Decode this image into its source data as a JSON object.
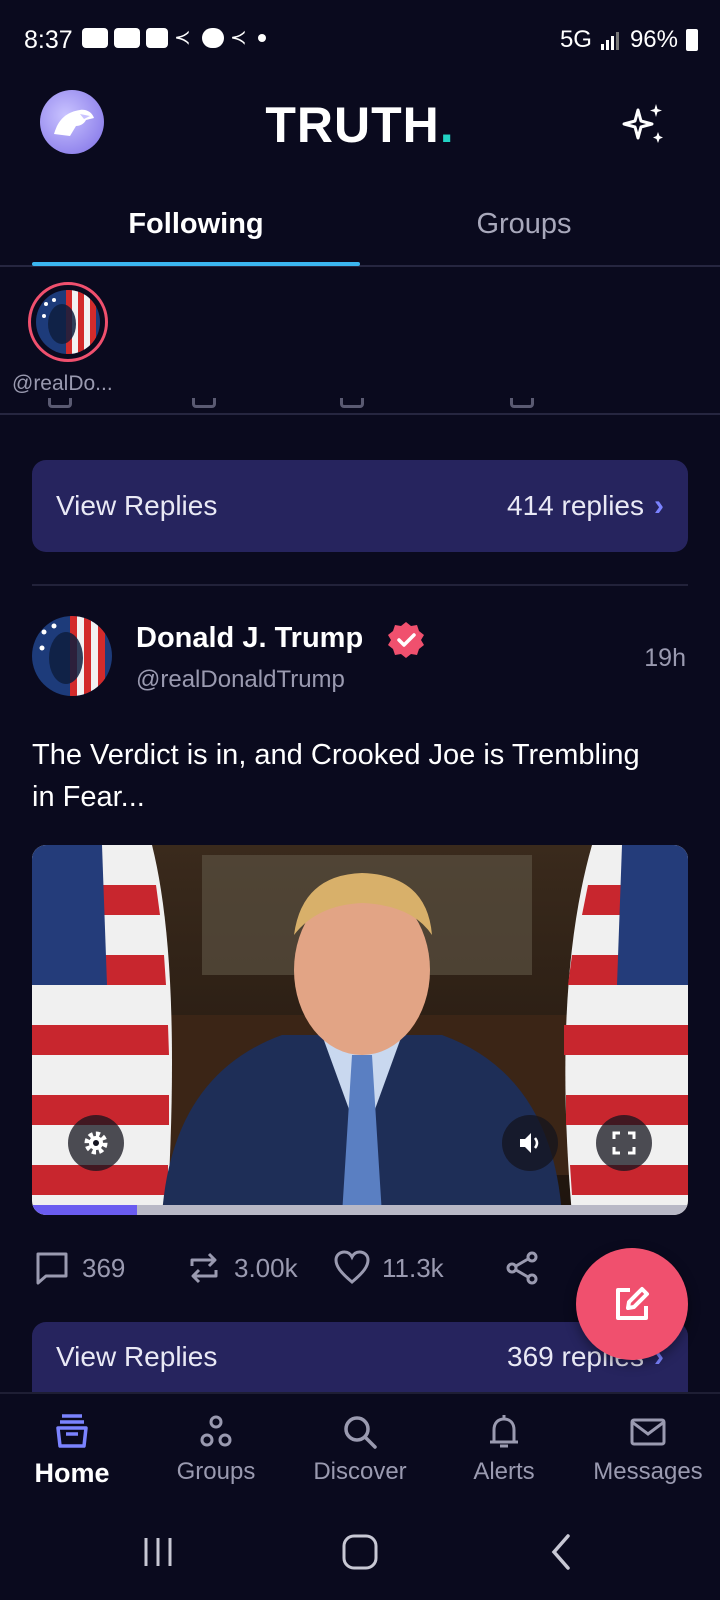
{
  "status_bar": {
    "time": "8:37",
    "network": "5G",
    "battery": "96%"
  },
  "header": {
    "brand": "TRUTH",
    "brand_dot": "."
  },
  "tabs": [
    {
      "label": "Following",
      "active": true
    },
    {
      "label": "Groups",
      "active": false
    }
  ],
  "stories": [
    {
      "handle": "@realDo..."
    }
  ],
  "previous_post": {
    "view_replies_label": "View Replies",
    "replies_count": "414 replies"
  },
  "post": {
    "author": "Donald J. Trump",
    "handle": "@realDonaldTrump",
    "time": "19h",
    "text": "The Verdict is in, and Crooked Joe is Trembling in Fear...",
    "video_progress": 0.16,
    "stats": {
      "replies": "369",
      "reposts": "3.00k",
      "likes": "11.3k"
    },
    "view_replies_label": "View Replies",
    "replies_count": "369 replies"
  },
  "bottom_nav": [
    {
      "label": "Home",
      "icon": "home-icon",
      "active": true
    },
    {
      "label": "Groups",
      "icon": "groups-icon",
      "active": false
    },
    {
      "label": "Discover",
      "icon": "search-icon",
      "active": false
    },
    {
      "label": "Alerts",
      "icon": "bell-icon",
      "active": false
    },
    {
      "label": "Messages",
      "icon": "mail-icon",
      "active": false
    }
  ],
  "colors": {
    "background": "#0a0a1e",
    "accent": "#3bb6f0",
    "brand_dot": "#22d3c5",
    "fab": "#f0506e",
    "replies_bar": "#26245e"
  }
}
